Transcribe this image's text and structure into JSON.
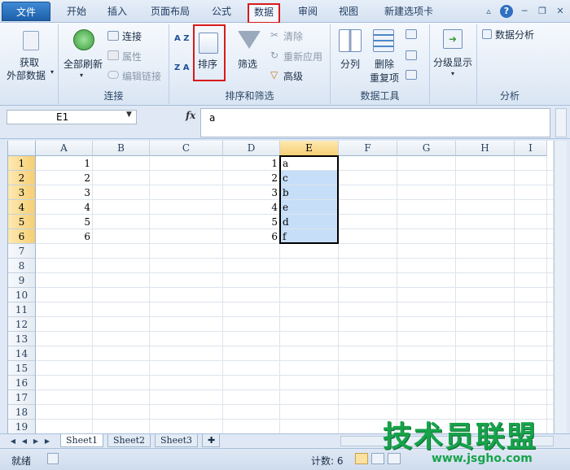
{
  "tabs": [
    {
      "label": "文件"
    },
    {
      "label": "开始"
    },
    {
      "label": "插入"
    },
    {
      "label": "页面布局"
    },
    {
      "label": "公式"
    },
    {
      "label": "数据"
    },
    {
      "label": "审阅"
    },
    {
      "label": "视图"
    },
    {
      "label": "新建选项卡"
    }
  ],
  "window_controls": {
    "help": "?"
  },
  "ribbon": {
    "get_external": {
      "line1": "获取",
      "line2": "外部数据"
    },
    "connections": {
      "refresh_all": "全部刷新",
      "connections": "连接",
      "properties": "属性",
      "edit_links": "编辑链接",
      "group_label": "连接"
    },
    "sort_filter": {
      "sort": "排序",
      "filter": "筛选",
      "clear": "清除",
      "reapply": "重新应用",
      "advanced": "高级",
      "group_label": "排序和筛选",
      "az": "A Z",
      "za": "Z A"
    },
    "data_tools": {
      "split": "分列",
      "remove_dup_1": "删除",
      "remove_dup_2": "重复项",
      "group_label": "数据工具"
    },
    "outline": {
      "label": "分级显示"
    },
    "analysis": {
      "label": "数据分析",
      "group_label": "分析"
    }
  },
  "formula_bar": {
    "name_box": "E1",
    "fx": "fx",
    "value": "a"
  },
  "columns": [
    "A",
    "B",
    "C",
    "D",
    "E",
    "F",
    "G",
    "H",
    "I"
  ],
  "rows": [
    "1",
    "2",
    "3",
    "4",
    "5",
    "6",
    "7",
    "8",
    "9",
    "10",
    "11",
    "12",
    "13",
    "14",
    "15",
    "16",
    "17",
    "18",
    "19"
  ],
  "cells": {
    "A": [
      "1",
      "2",
      "3",
      "4",
      "5",
      "6"
    ],
    "D": [
      "1",
      "2",
      "3",
      "4",
      "5",
      "6"
    ],
    "E": [
      "a",
      "c",
      "b",
      "e",
      "d",
      "f"
    ]
  },
  "sheets": [
    "Sheet1",
    "Sheet2",
    "Sheet3"
  ],
  "status": {
    "ready": "就绪",
    "count": "计数: 6"
  },
  "watermark": {
    "main": "技术员联盟",
    "url": "www.jsgho.com"
  },
  "colors": {
    "highlight_box": "#d81a1a",
    "selection_fill": "#c7def8",
    "watermark": "#16a34a"
  }
}
